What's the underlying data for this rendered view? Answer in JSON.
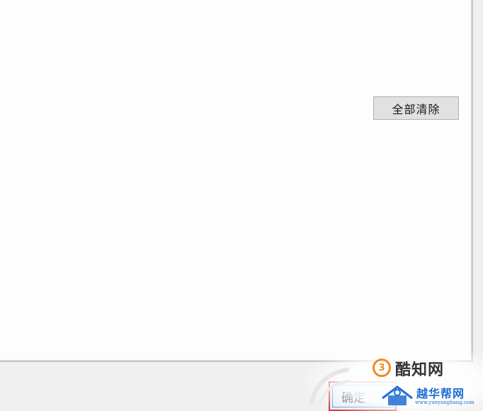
{
  "dialog": {
    "clear_all_label": "全部清除",
    "ok_label": "确定"
  },
  "watermarks": {
    "top_brand": "酷知网",
    "bottom_brand": "越华帮网",
    "bottom_url": "www.yueyangbang.com"
  },
  "colors": {
    "dialog_bg": "#f0f0f0",
    "pane_bg": "#fdfdfd",
    "ok_highlight": "#d93a3a",
    "focus_blue": "#4a8fd6",
    "watermark_orange": "#f08a24",
    "watermark_blue": "#1f6fd1"
  }
}
